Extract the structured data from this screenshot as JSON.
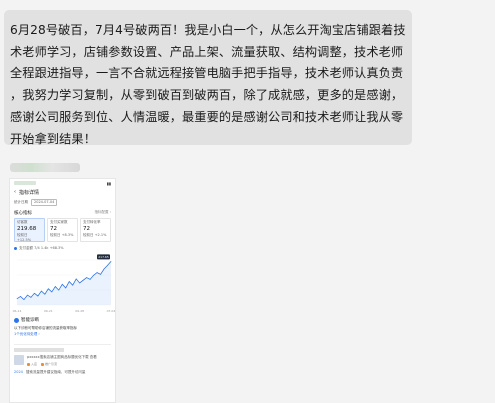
{
  "message": {
    "lines": [
      "6月28号破百，7月4号破两百！我是小白一个，从怎么开淘宝店铺跟着技",
      "术老师学习，店铺参数设置、产品上架、流量获取、结构调整，技术老师",
      "全程跟进指导，一言不合就远程接管电脑手把手指导，技术老师认真负责",
      "，我努力学习复制，从零到破百到破两百，除了成就感，更多的是感谢，",
      "感谢公司服务到位、人情温暖，最重要的是感谢公司和技术老师让我从零",
      "开始拿到结果！"
    ]
  },
  "screenshot": {
    "nav_title": "指标详情",
    "back_glyph": "‹",
    "date_label": "统计日期",
    "date_btn": "2024-07-04",
    "section_title": "核心指标",
    "section_right": "指标配置 ›",
    "metrics": [
      {
        "label": "访客数",
        "value": "219.68",
        "sub": "较前日 +12.5%"
      },
      {
        "label": "支付买家数",
        "value": "72",
        "sub": "较前日 +8.3%"
      },
      {
        "label": "支付转化率",
        "value": "72",
        "sub": "较前日 +2.1%"
      }
    ],
    "legend_text": "支付金额  7/4  1.4k  +68.3%",
    "chart_badge": "217.65",
    "chart_xlabels": [
      "06-14",
      "06-21",
      "06-28",
      "07-04"
    ],
    "smart_title": "智能诊断",
    "smart_text": "以下诊断可帮助你店铺的流量获取率指标",
    "smart_link": "1个优化待处理 ›",
    "card_text": "pxxxxx搜索店铺主图商品标题优化下载 查看",
    "card_tag1": "入店",
    "card_tag2": "推广引流",
    "card2_key": "2024",
    "card2_text": "搜索流量提升建议指南，可提升访问量"
  },
  "chart_data": {
    "type": "line",
    "series": [
      {
        "values": [
          14,
          19,
          12,
          22,
          17,
          26,
          20,
          31,
          24,
          36,
          29,
          41,
          33,
          46,
          38,
          52,
          44,
          58,
          49,
          55,
          61,
          57,
          66,
          72,
          68,
          80,
          88,
          97
        ]
      }
    ],
    "ylim": [
      0,
      100
    ],
    "colors": {
      "line": "#2f73e6",
      "fill": "#dce9fc"
    }
  }
}
